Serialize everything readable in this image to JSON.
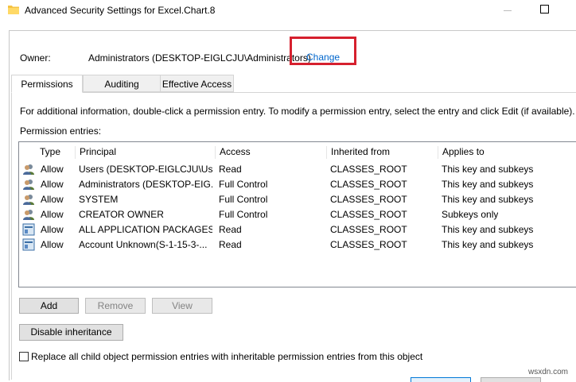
{
  "window": {
    "title": "Advanced Security Settings for Excel.Chart.8"
  },
  "owner": {
    "label": "Owner:",
    "value": "Administrators (DESKTOP-EIGLCJU\\Administrators)",
    "change_link": "Change"
  },
  "tabs": [
    {
      "label": "Permissions",
      "selected": true
    },
    {
      "label": "Auditing",
      "selected": false
    },
    {
      "label": "Effective Access",
      "selected": false
    }
  ],
  "info_text": "For additional information, double-click a permission entry. To modify a permission entry, select the entry and click Edit (if available).",
  "entries_label": "Permission entries:",
  "columns": [
    "Type",
    "Principal",
    "Access",
    "Inherited from",
    "Applies to"
  ],
  "rows": [
    {
      "icon": "users-icon",
      "type": "Allow",
      "principal": "Users (DESKTOP-EIGLCJU\\Use...",
      "access": "Read",
      "inherited": "CLASSES_ROOT",
      "applies": "This key and subkeys"
    },
    {
      "icon": "users-icon",
      "type": "Allow",
      "principal": "Administrators (DESKTOP-EIG...",
      "access": "Full Control",
      "inherited": "CLASSES_ROOT",
      "applies": "This key and subkeys"
    },
    {
      "icon": "users-icon",
      "type": "Allow",
      "principal": "SYSTEM",
      "access": "Full Control",
      "inherited": "CLASSES_ROOT",
      "applies": "This key and subkeys"
    },
    {
      "icon": "users-icon",
      "type": "Allow",
      "principal": "CREATOR OWNER",
      "access": "Full Control",
      "inherited": "CLASSES_ROOT",
      "applies": "Subkeys only"
    },
    {
      "icon": "app-packages-icon",
      "type": "Allow",
      "principal": "ALL APPLICATION PACKAGES",
      "access": "Read",
      "inherited": "CLASSES_ROOT",
      "applies": "This key and subkeys"
    },
    {
      "icon": "app-packages-icon",
      "type": "Allow",
      "principal": "Account Unknown(S-1-15-3-...",
      "access": "Read",
      "inherited": "CLASSES_ROOT",
      "applies": "This key and subkeys"
    }
  ],
  "buttons": {
    "add": "Add",
    "remove": "Remove",
    "view": "View",
    "disable_inheritance": "Disable inheritance"
  },
  "replace_checkbox": {
    "label": "Replace all child object permission entries with inheritable permission entries from this object",
    "checked": false
  },
  "watermark": "wsxdn.com",
  "colors": {
    "link": "#0066cc",
    "highlight": "#d6202e"
  }
}
